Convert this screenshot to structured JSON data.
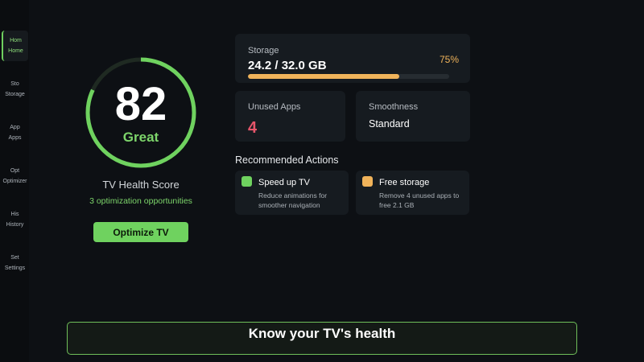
{
  "colors": {
    "accent": "#6fd25f",
    "storage": "#f0b35a",
    "warning": "#e5556a",
    "background": "#0d1014",
    "card": "#161b20"
  },
  "sidebar": {
    "items": [
      {
        "abbr": "Hom",
        "label": "Home",
        "active": true
      },
      {
        "abbr": "Sto",
        "label": "Storage",
        "active": false
      },
      {
        "abbr": "App",
        "label": "Apps",
        "active": false
      },
      {
        "abbr": "Opt",
        "label": "Optimizer",
        "active": false
      },
      {
        "abbr": "His",
        "label": "History",
        "active": false
      },
      {
        "abbr": "Set",
        "label": "Settings",
        "active": false
      }
    ]
  },
  "score": {
    "value": "82",
    "grade": "Great",
    "title": "TV Health Score",
    "subtitle": "3 optimization opportunities",
    "button_label": "Optimize TV",
    "percent": 82
  },
  "storage": {
    "label": "Storage",
    "value": "24.2 / 32.0 GB",
    "percent_label": "75%",
    "percent": 75
  },
  "unused_apps": {
    "label": "Unused Apps",
    "value": "4"
  },
  "smoothness": {
    "label": "Smoothness",
    "value": "Standard"
  },
  "recommended": {
    "title": "Recommended Actions",
    "actions": [
      {
        "title": "Speed up TV",
        "description": "Reduce animations for smoother navigation",
        "color": "#6fd25f"
      },
      {
        "title": "Free storage",
        "description": "Remove 4 unused apps to free 2.1 GB",
        "color": "#f0b35a"
      }
    ]
  },
  "caption": "Know your TV's health"
}
